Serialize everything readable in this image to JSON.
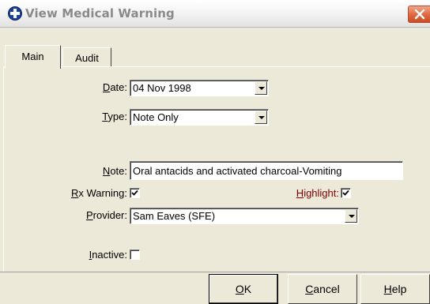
{
  "window": {
    "title": "View Medical Warning"
  },
  "tabs": [
    {
      "label": "Main",
      "active": true
    },
    {
      "label": "Audit",
      "active": false
    }
  ],
  "form": {
    "date": {
      "label_prefix": "",
      "label_underline": "D",
      "label_rest": "ate:",
      "value": "04 Nov 1998"
    },
    "type": {
      "label_prefix": "",
      "label_underline": "T",
      "label_rest": "ype:",
      "value": "Note Only"
    },
    "note": {
      "label_prefix": "",
      "label_underline": "N",
      "label_rest": "ote:",
      "value": "Oral antacids and activated charcoal-Vomiting"
    },
    "rx_warning": {
      "label_prefix": "",
      "label_underline": "R",
      "label_rest": "x Warning:",
      "checked": true
    },
    "highlight": {
      "label_prefix": "",
      "label_underline": "H",
      "label_rest": "ighlight:",
      "checked": true
    },
    "provider": {
      "label_prefix": "",
      "label_underline": "P",
      "label_rest": "rovider:",
      "value": "Sam Eaves (SFE)"
    },
    "inactive": {
      "label_prefix": "",
      "label_underline": "I",
      "label_rest": "nactive:",
      "checked": false
    }
  },
  "buttons": {
    "ok": {
      "underline": "O",
      "rest": "K"
    },
    "cancel": {
      "underline": "C",
      "rest": "ancel"
    },
    "help": {
      "underline": "H",
      "rest": "elp"
    }
  },
  "colors": {
    "highlight_label": "#800000",
    "title_text": "#8a8a8a",
    "close_button": "#e06b44"
  },
  "icons": {
    "window": "medical-cross-icon",
    "close": "close-icon",
    "dropdown": "chevron-down-icon",
    "check": "checkmark-icon"
  }
}
